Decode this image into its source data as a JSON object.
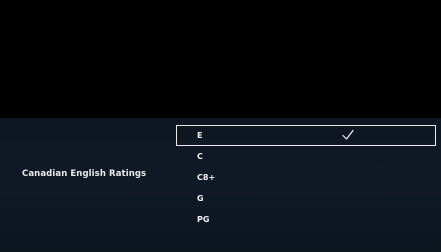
{
  "setting": {
    "label": "Canadian English Ratings"
  },
  "options": [
    {
      "label": "E",
      "selected": true
    },
    {
      "label": "C",
      "selected": false
    },
    {
      "label": "C8+",
      "selected": false
    },
    {
      "label": "G",
      "selected": false
    },
    {
      "label": "PG",
      "selected": false
    }
  ],
  "icons": {
    "selected_marker": "checkmark-icon"
  },
  "colors": {
    "background": "#000000",
    "panel": "#101a26",
    "text": "#f2f4f6",
    "focus_border": "#e8ecef"
  }
}
